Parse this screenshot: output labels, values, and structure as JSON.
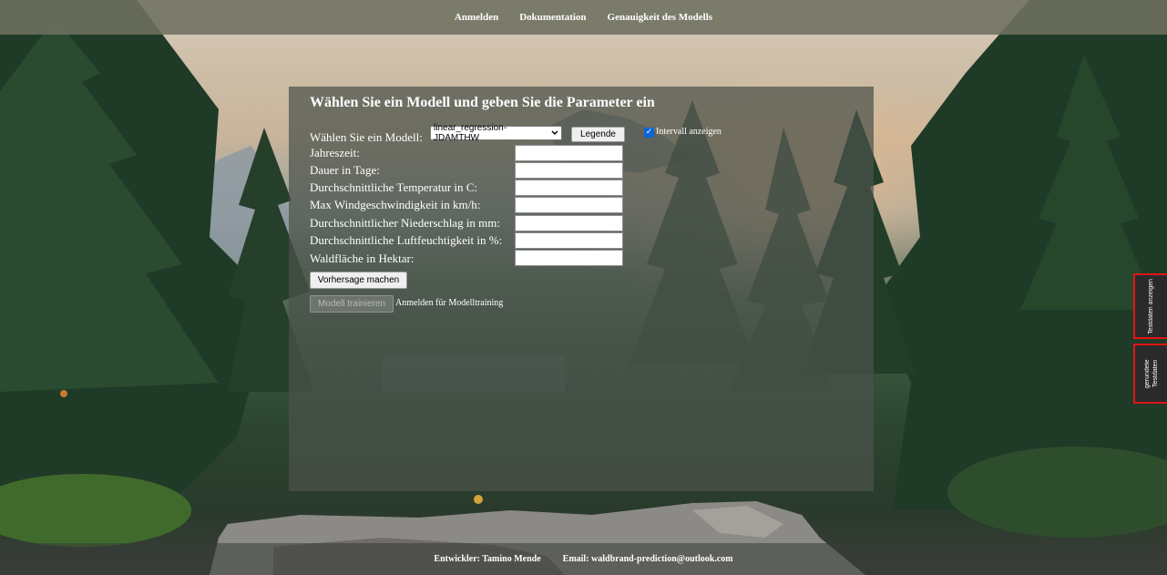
{
  "nav": {
    "items": [
      "Anmelden",
      "Dokumentation",
      "Genauigkeit des Modells"
    ]
  },
  "panel": {
    "title": "Wählen Sie ein Modell und geben Sie die Parameter ein",
    "model_label": "Wählen Sie ein Modell:",
    "model_selected": "linear_regression-JDAMTHW",
    "legend_button": "Legende",
    "interval_checkbox_label": "Intervall anzeigen",
    "interval_checked": true,
    "fields": [
      {
        "label": "Jahreszeit:",
        "value": ""
      },
      {
        "label": "Dauer in Tage:",
        "value": ""
      },
      {
        "label": "Durchschnittliche Temperatur in C:",
        "value": ""
      },
      {
        "label": "Max Windgeschwindigkeit in km/h:",
        "value": ""
      },
      {
        "label": "Durchschnittlicher Niederschlag in mm:",
        "value": ""
      },
      {
        "label": "Durchschnittliche Luftfeuchtigkeit in %:",
        "value": ""
      },
      {
        "label": "Waldfläche in Hektar:",
        "value": ""
      }
    ],
    "predict_button": "Vorhersage machen",
    "train_button": "Modell trainieren",
    "train_login_hint": "Anmelden für Modelltraining"
  },
  "side_tabs": [
    "Testdaten anzeigen",
    "gerundete Testdaten"
  ],
  "footer": {
    "developer": "Entwickler: Tamino Mende",
    "email": "Email: waldbrand-prediction@outlook.com"
  },
  "colors": {
    "nav_bg": "#6e7060",
    "panel_bg": "#4b524b",
    "side_tab_border": "#e01515",
    "checkbox_accent": "#0a66d8"
  },
  "icons": {
    "checkbox": "check-mark",
    "select": "chevron-down-icon"
  }
}
